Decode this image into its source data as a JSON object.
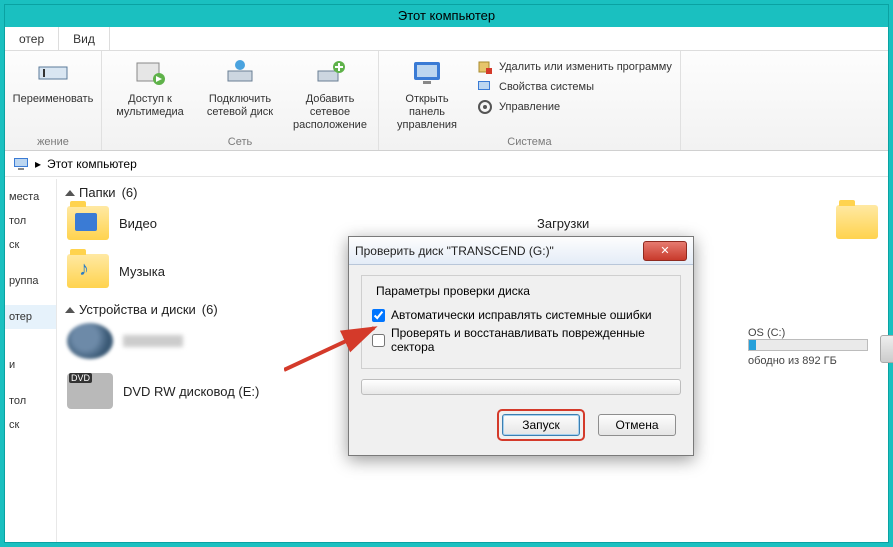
{
  "window": {
    "title": "Этот компьютер"
  },
  "tabs": {
    "file": "отер",
    "view": "Вид"
  },
  "ribbon": {
    "rename": "Переименовать",
    "media": "Доступ к мультимедиа",
    "netdrive": "Подключить сетевой диск",
    "addnet": "Добавить сетевое расположение",
    "ctrlpanel": "Открыть панель управления",
    "uninstall": "Удалить или изменить программу",
    "sysprops": "Свойства системы",
    "manage": "Управление",
    "group_org": "жение",
    "group_net": "Сеть",
    "group_sys": "Система"
  },
  "breadcrumb": {
    "root_sep": "▸",
    "root": "Этот компьютер"
  },
  "sidebar": {
    "items": [
      "места",
      "тол",
      "ск",
      "",
      "руппа",
      "",
      "отер",
      "",
      "",
      "и",
      "",
      "тол",
      "ск"
    ]
  },
  "sections": {
    "folders": {
      "label": "Папки",
      "count": "(6)"
    },
    "devices": {
      "label": "Устройства и диски",
      "count": "(6)"
    }
  },
  "folders": {
    "video": "Видео",
    "music": "Музыка",
    "downloads": "Загрузки"
  },
  "devices": {
    "dvd": "DVD RW дисковод (E:)",
    "os_drive": "OS (C:)",
    "os_free": "ободно из 892 ГБ"
  },
  "dialog": {
    "title": "Проверить диск \"TRANSCEND (G:)\"",
    "group": "Параметры проверки диска",
    "opt1": "Автоматически исправлять системные ошибки",
    "opt2": "Проверять и восстанавливать поврежденные сектора",
    "opt1_checked": true,
    "opt2_checked": false,
    "start": "Запуск",
    "cancel": "Отмена"
  }
}
